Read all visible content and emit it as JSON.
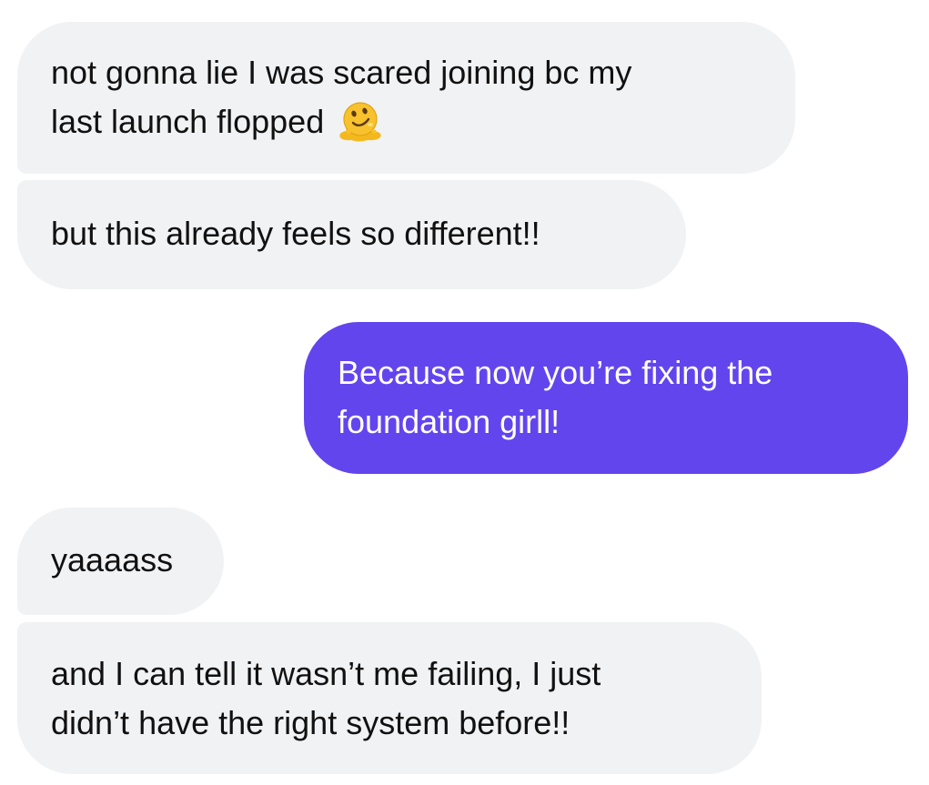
{
  "messages": [
    {
      "direction": "incoming",
      "lines": [
        "not gonna lie I was scared joining bc my",
        "last launch flopped"
      ],
      "emoji": "melting-face-icon"
    },
    {
      "direction": "incoming",
      "lines": [
        "but this already feels so different!!"
      ]
    },
    {
      "direction": "outgoing",
      "lines": [
        "Because now you’re fixing the",
        "foundation girll!"
      ]
    },
    {
      "direction": "incoming",
      "lines": [
        "yaaaass"
      ]
    },
    {
      "direction": "incoming",
      "lines": [
        "and I can tell it wasn’t me failing, I just",
        "didn’t have the right system before!!"
      ]
    }
  ],
  "colors": {
    "incoming_bubble": "#f1f2f4",
    "incoming_text": "#111111",
    "outgoing_bubble": "#6345ee",
    "outgoing_text": "#ffffff",
    "emoji": "#f7c22d"
  }
}
